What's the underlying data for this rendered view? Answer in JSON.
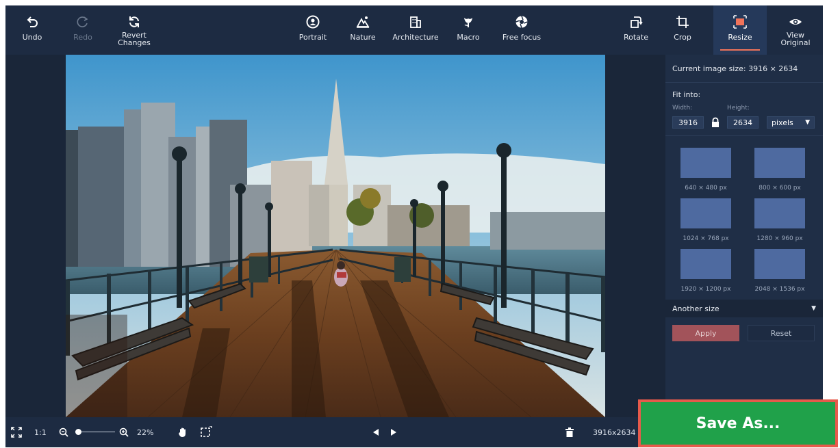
{
  "toolbar": {
    "undo": "Undo",
    "redo": "Redo",
    "revert": "Revert\nChanges",
    "portrait": "Portrait",
    "nature": "Nature",
    "architecture": "Architecture",
    "macro": "Macro",
    "free_focus": "Free focus",
    "rotate": "Rotate",
    "crop": "Crop",
    "resize": "Resize",
    "view_original": "View\nOriginal"
  },
  "panel": {
    "current_size": "Current image size: 3916 × 2634",
    "fit_into": "Fit into:",
    "width_label": "Width:",
    "height_label": "Height:",
    "width_value": "3916",
    "height_value": "2634",
    "units": "pixels",
    "presets": [
      "640 × 480 px",
      "800 × 600 px",
      "1024 × 768 px",
      "1280 × 960 px",
      "1920 × 1200 px",
      "2048 × 1536 px"
    ],
    "another_size": "Another size",
    "apply": "Apply",
    "reset": "Reset"
  },
  "bottom": {
    "one_to_one": "1:1",
    "zoom_percent": "22%",
    "dimensions": "3916x2634",
    "save_as": "Save As..."
  },
  "colors": {
    "save_green": "#20a14a",
    "highlight_red": "#e75a4b",
    "accent": "#f0735a"
  }
}
